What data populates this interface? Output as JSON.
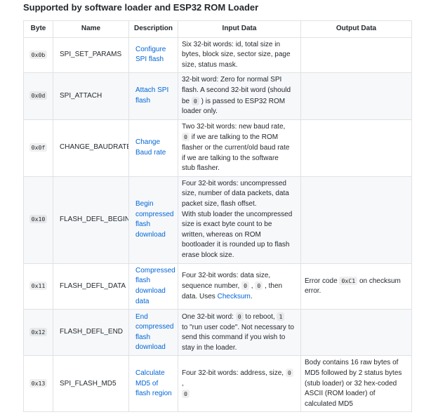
{
  "heading": "Supported by software loader and ESP32 ROM Loader",
  "columns": {
    "byte": "Byte",
    "name": "Name",
    "description": "Description",
    "input": "Input Data",
    "output": "Output Data"
  },
  "rows": [
    {
      "byte": "0x0b",
      "name": "SPI_SET_PARAMS",
      "description": [
        "Configure",
        "SPI flash"
      ],
      "input": [
        "Six 32-bit words: id, total size in",
        "bytes, block size, sector size, page",
        "size, status mask."
      ],
      "output": []
    },
    {
      "byte": "0x0d",
      "name": "SPI_ATTACH",
      "description": [
        "Attach SPI",
        "flash"
      ],
      "input": [
        "32-bit word: Zero for normal SPI",
        "flash. A second 32-bit word (should",
        "be {0} ) is passed to ESP32 ROM",
        "loader only."
      ],
      "input_code": "0",
      "output": []
    },
    {
      "byte": "0x0f",
      "name": "CHANGE_BAUDRATE",
      "description": [
        "Change",
        "Baud rate"
      ],
      "input": [
        "Two 32-bit words: new baud rate,",
        "{0}  if we are talking to the ROM",
        "flasher or the current/old baud rate",
        "if we are talking to the software",
        "stub flasher."
      ],
      "input_code": "0",
      "output": []
    },
    {
      "byte": "0x10",
      "name": "FLASH_DEFL_BEGIN",
      "description": [
        "Begin",
        "compressed",
        "flash",
        "download"
      ],
      "input": [
        "Four 32-bit words: uncompressed",
        "size, number of data packets, data",
        "packet size, flash offset.",
        "With stub loader the uncompressed",
        "size is exact byte count to be",
        "written, whereas on ROM",
        "bootloader it is rounded up to flash",
        "erase block size."
      ],
      "output": []
    },
    {
      "byte": "0x11",
      "name": "FLASH_DEFL_DATA",
      "description": [
        "Compressed",
        "flash",
        "download",
        "data"
      ],
      "input": [
        "Four 32-bit words: data size,",
        "sequence number, {0} , {0} , then",
        "data. Uses {link}."
      ],
      "input_code": "0",
      "input_link": "Checksum",
      "output": [
        "Error code {0xC1}  on checksum",
        "error."
      ],
      "output_code": "0xC1"
    },
    {
      "byte": "0x12",
      "name": "FLASH_DEFL_END",
      "description": [
        "End",
        "compressed",
        "flash",
        "download"
      ],
      "input": [
        "One 32-bit word: {0}  to reboot, {1}",
        "to \"run user code\". Not necessary to",
        "send this command if you wish to",
        "stay in the loader."
      ],
      "input_code": "0",
      "input_code2": "1",
      "output": []
    },
    {
      "byte": "0x13",
      "name": "SPI_FLASH_MD5",
      "description": [
        "Calculate",
        "MD5 of",
        "flash region"
      ],
      "input": [
        "Four 32-bit words: address, size, {0} ,",
        "{0}"
      ],
      "input_code": "0",
      "output": [
        "Body contains 16 raw bytes of",
        "MD5 followed by 2 status bytes",
        "(stub loader) or 32 hex-coded",
        "ASCII (ROM loader) of",
        "calculated MD5"
      ]
    }
  ]
}
